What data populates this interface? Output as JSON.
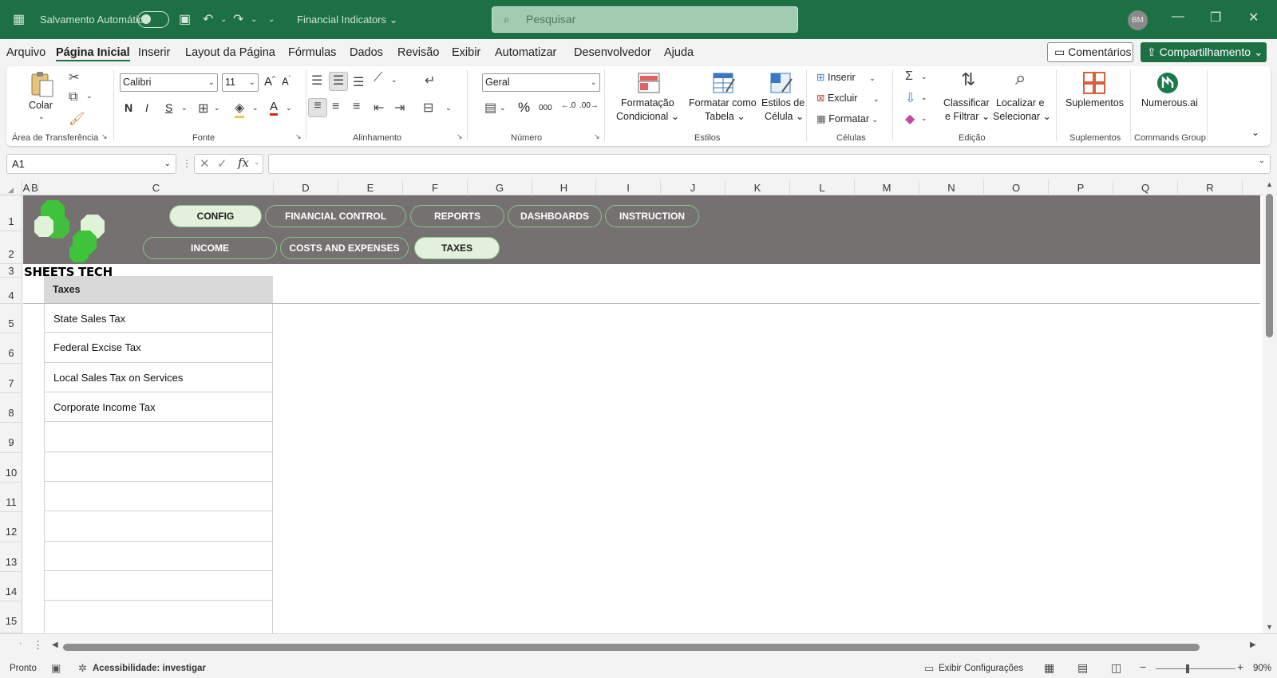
{
  "titlebar": {
    "autosave_label": "Salvamento Automático",
    "doc_title": "Financial Indicators",
    "search_placeholder": "Pesquisar",
    "avatar_initials": "BM"
  },
  "menu": {
    "tabs": [
      "Arquivo",
      "Página Inicial",
      "Inserir",
      "Layout da Página",
      "Fórmulas",
      "Dados",
      "Revisão",
      "Exibir",
      "Automatizar",
      "Desenvolvedor",
      "Ajuda"
    ],
    "active_tab": "Página Inicial",
    "comments_label": "Comentários",
    "share_label": "Compartilhamento"
  },
  "ribbon": {
    "clipboard": {
      "paste_label": "Colar",
      "group_label": "Área de Transferência"
    },
    "font": {
      "font_name": "Calibri",
      "font_size": "11",
      "group_label": "Fonte"
    },
    "alignment": {
      "group_label": "Alinhamento"
    },
    "number": {
      "format": "Geral",
      "group_label": "Número"
    },
    "styles": {
      "conditional_label_1": "Formatação",
      "conditional_label_2": "Condicional",
      "table_label_1": "Formatar como",
      "table_label_2": "Tabela",
      "cellstyles_label_1": "Estilos de",
      "cellstyles_label_2": "Célula",
      "group_label": "Estilos"
    },
    "cells": {
      "insert": "Inserir",
      "delete": "Excluir",
      "format": "Formatar",
      "group_label": "Células"
    },
    "editing": {
      "sort_label_1": "Classificar",
      "sort_label_2": "e Filtrar",
      "find_label_1": "Localizar e",
      "find_label_2": "Selecionar",
      "group_label": "Edição"
    },
    "addins": {
      "label": "Suplementos",
      "group_label": "Suplementos"
    },
    "commands": {
      "label": "Numerous.ai",
      "group_label": "Commands Group"
    }
  },
  "formula_bar": {
    "name_box": "A1",
    "fx": "fx"
  },
  "columns": [
    "A",
    "B",
    "C",
    "D",
    "E",
    "F",
    "G",
    "H",
    "I",
    "J",
    "K",
    "L",
    "M",
    "N",
    "O",
    "P",
    "Q",
    "R"
  ],
  "rows": [
    "1",
    "2",
    "3",
    "4",
    "5",
    "6",
    "7",
    "8",
    "9",
    "10",
    "11",
    "12",
    "13",
    "14",
    "15"
  ],
  "banner": {
    "nav_row1": [
      "CONFIG",
      "FINANCIAL CONTROL",
      "REPORTS",
      "DASHBOARDS",
      "INSTRUCTION"
    ],
    "nav_row2": [
      "INCOME",
      "COSTS AND EXPENSES",
      "TAXES"
    ],
    "active_row1": "CONFIG",
    "active_row2": "TAXES",
    "brand": "SHEETS TECH",
    "logo_color": "#3ec43a"
  },
  "table": {
    "header": "Taxes",
    "items": [
      "State Sales Tax",
      "Federal Excise Tax",
      "Local Sales Tax on Services",
      "Corporate Income Tax",
      "",
      "",
      "",
      "",
      "",
      "",
      ""
    ]
  },
  "statusbar": {
    "ready": "Pronto",
    "accessibility": "Acessibilidade: investigar",
    "display_settings": "Exibir Configurações",
    "zoom": "90%"
  },
  "colors": {
    "accent": "#1d7044",
    "banner": "#757171",
    "pill_active": "#e3f1dc",
    "pill_border": "#8dc08a"
  }
}
